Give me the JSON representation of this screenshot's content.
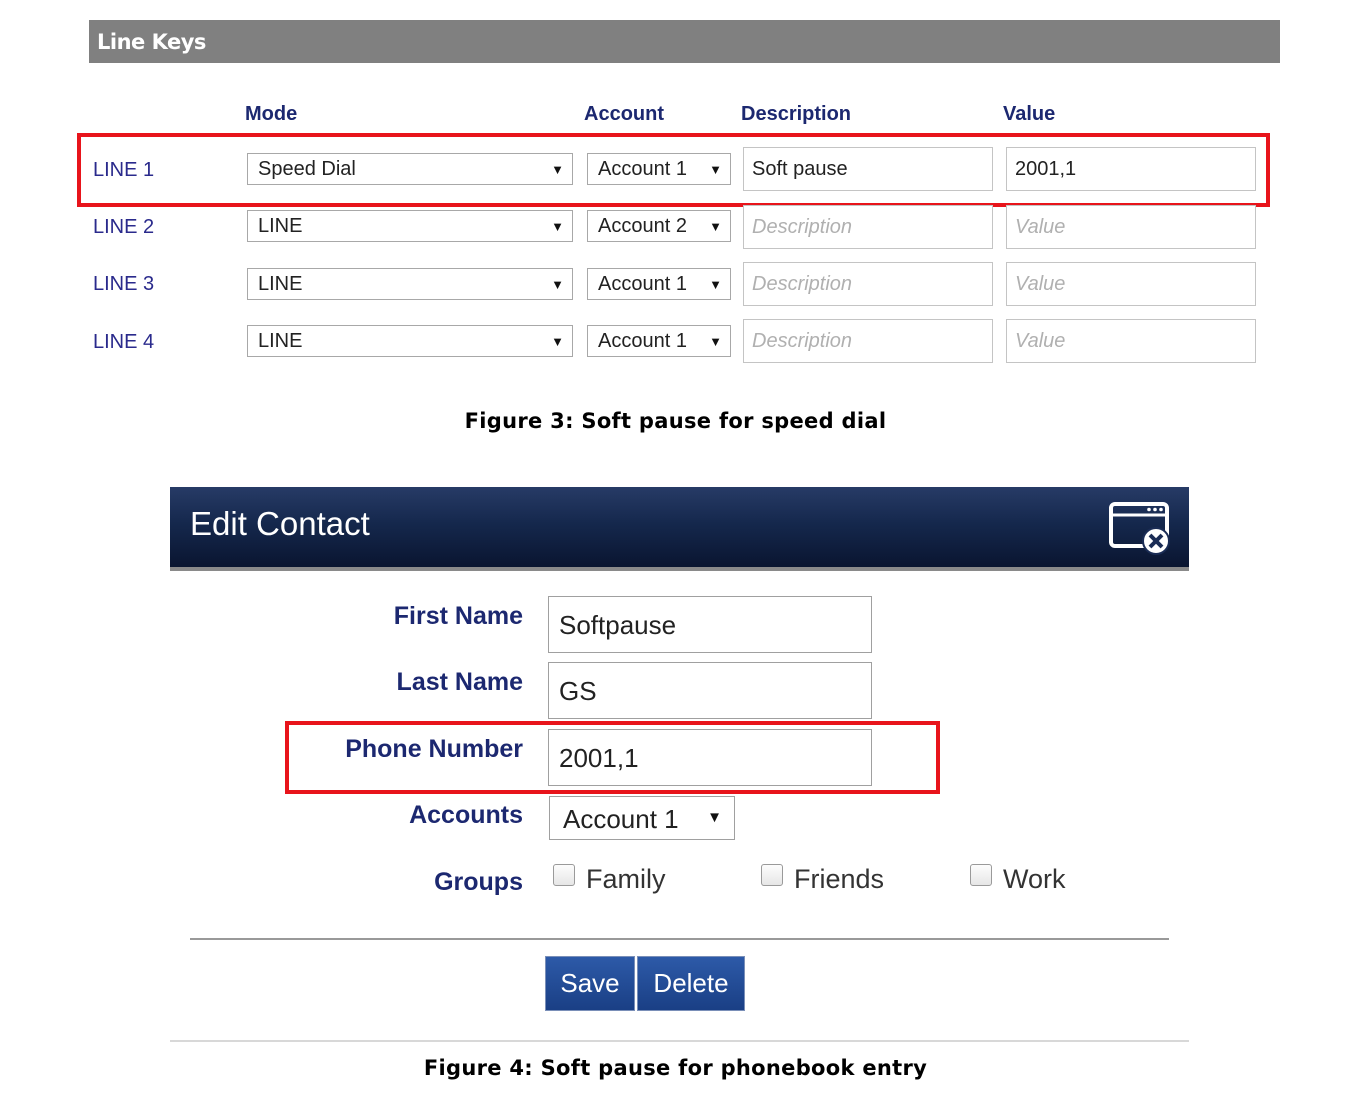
{
  "line_keys": {
    "title": "Line Keys",
    "columns": {
      "mode": "Mode",
      "account": "Account",
      "description": "Description",
      "value": "Value"
    },
    "rows": [
      {
        "label": "LINE 1",
        "mode": "Speed Dial",
        "account": "Account 1",
        "description": "Soft pause",
        "value": "2001,1"
      },
      {
        "label": "LINE 2",
        "mode": "LINE",
        "account": "Account 2",
        "description_placeholder": "Description",
        "value_placeholder": "Value"
      },
      {
        "label": "LINE 3",
        "mode": "LINE",
        "account": "Account 1",
        "description_placeholder": "Description",
        "value_placeholder": "Value"
      },
      {
        "label": "LINE 4",
        "mode": "LINE",
        "account": "Account 1",
        "description_placeholder": "Description",
        "value_placeholder": "Value"
      }
    ],
    "caption": "Figure 3: Soft pause for speed dial"
  },
  "edit_contact": {
    "title": "Edit Contact",
    "labels": {
      "first_name": "First Name",
      "last_name": "Last Name",
      "phone_number": "Phone Number",
      "accounts": "Accounts",
      "groups": "Groups"
    },
    "values": {
      "first_name": "Softpause",
      "last_name": "GS",
      "phone_number": "2001,1",
      "account": "Account 1"
    },
    "groups": [
      "Family",
      "Friends",
      "Work"
    ],
    "buttons": {
      "save": "Save",
      "delete": "Delete"
    },
    "caption": "Figure 4: Soft pause for phonebook entry"
  },
  "colors": {
    "highlight": "#e8141b",
    "label_navy": "#1c2870",
    "header_gray": "#808080",
    "button_blue": "#1a3f85"
  }
}
